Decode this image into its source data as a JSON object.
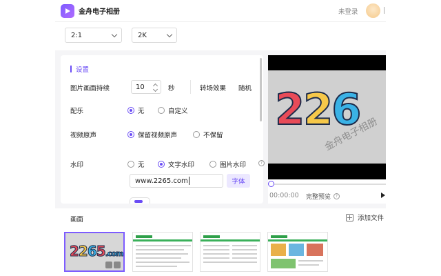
{
  "window": {
    "title": "金舟电子相册",
    "login_label": "未登录"
  },
  "toolbar": {
    "ratio": "2:1",
    "resolution": "2K"
  },
  "settings": {
    "section_title": "设置",
    "duration_label": "图片画面持续",
    "duration_value": "10",
    "duration_unit": "秒",
    "transition_label": "转场效果",
    "transition_value": "随机",
    "music_label": "配乐",
    "music_options": [
      "无",
      "自定义"
    ],
    "music_selected": "无",
    "audio_label": "视频原声",
    "audio_options": [
      "保留视频原声",
      "不保留"
    ],
    "audio_selected": "保留视频原声",
    "watermark_label": "水印",
    "watermark_options": [
      "无",
      "文字水印",
      "图片水印"
    ],
    "watermark_selected": "文字水印",
    "watermark_text": "www.2265.com",
    "font_button": "字体"
  },
  "preview": {
    "logo_text": [
      "2",
      "2",
      "6"
    ],
    "watermark_overlay": "金舟电子相册",
    "timecode": "00:00:00",
    "full_preview_label": "完整预览",
    "progress": 0
  },
  "bottom": {
    "title": "画面",
    "add_file_label": "添加文件",
    "thumbnails": [
      {
        "logo": [
          "2",
          "2",
          "6",
          "5",
          ".com"
        ]
      }
    ]
  }
}
